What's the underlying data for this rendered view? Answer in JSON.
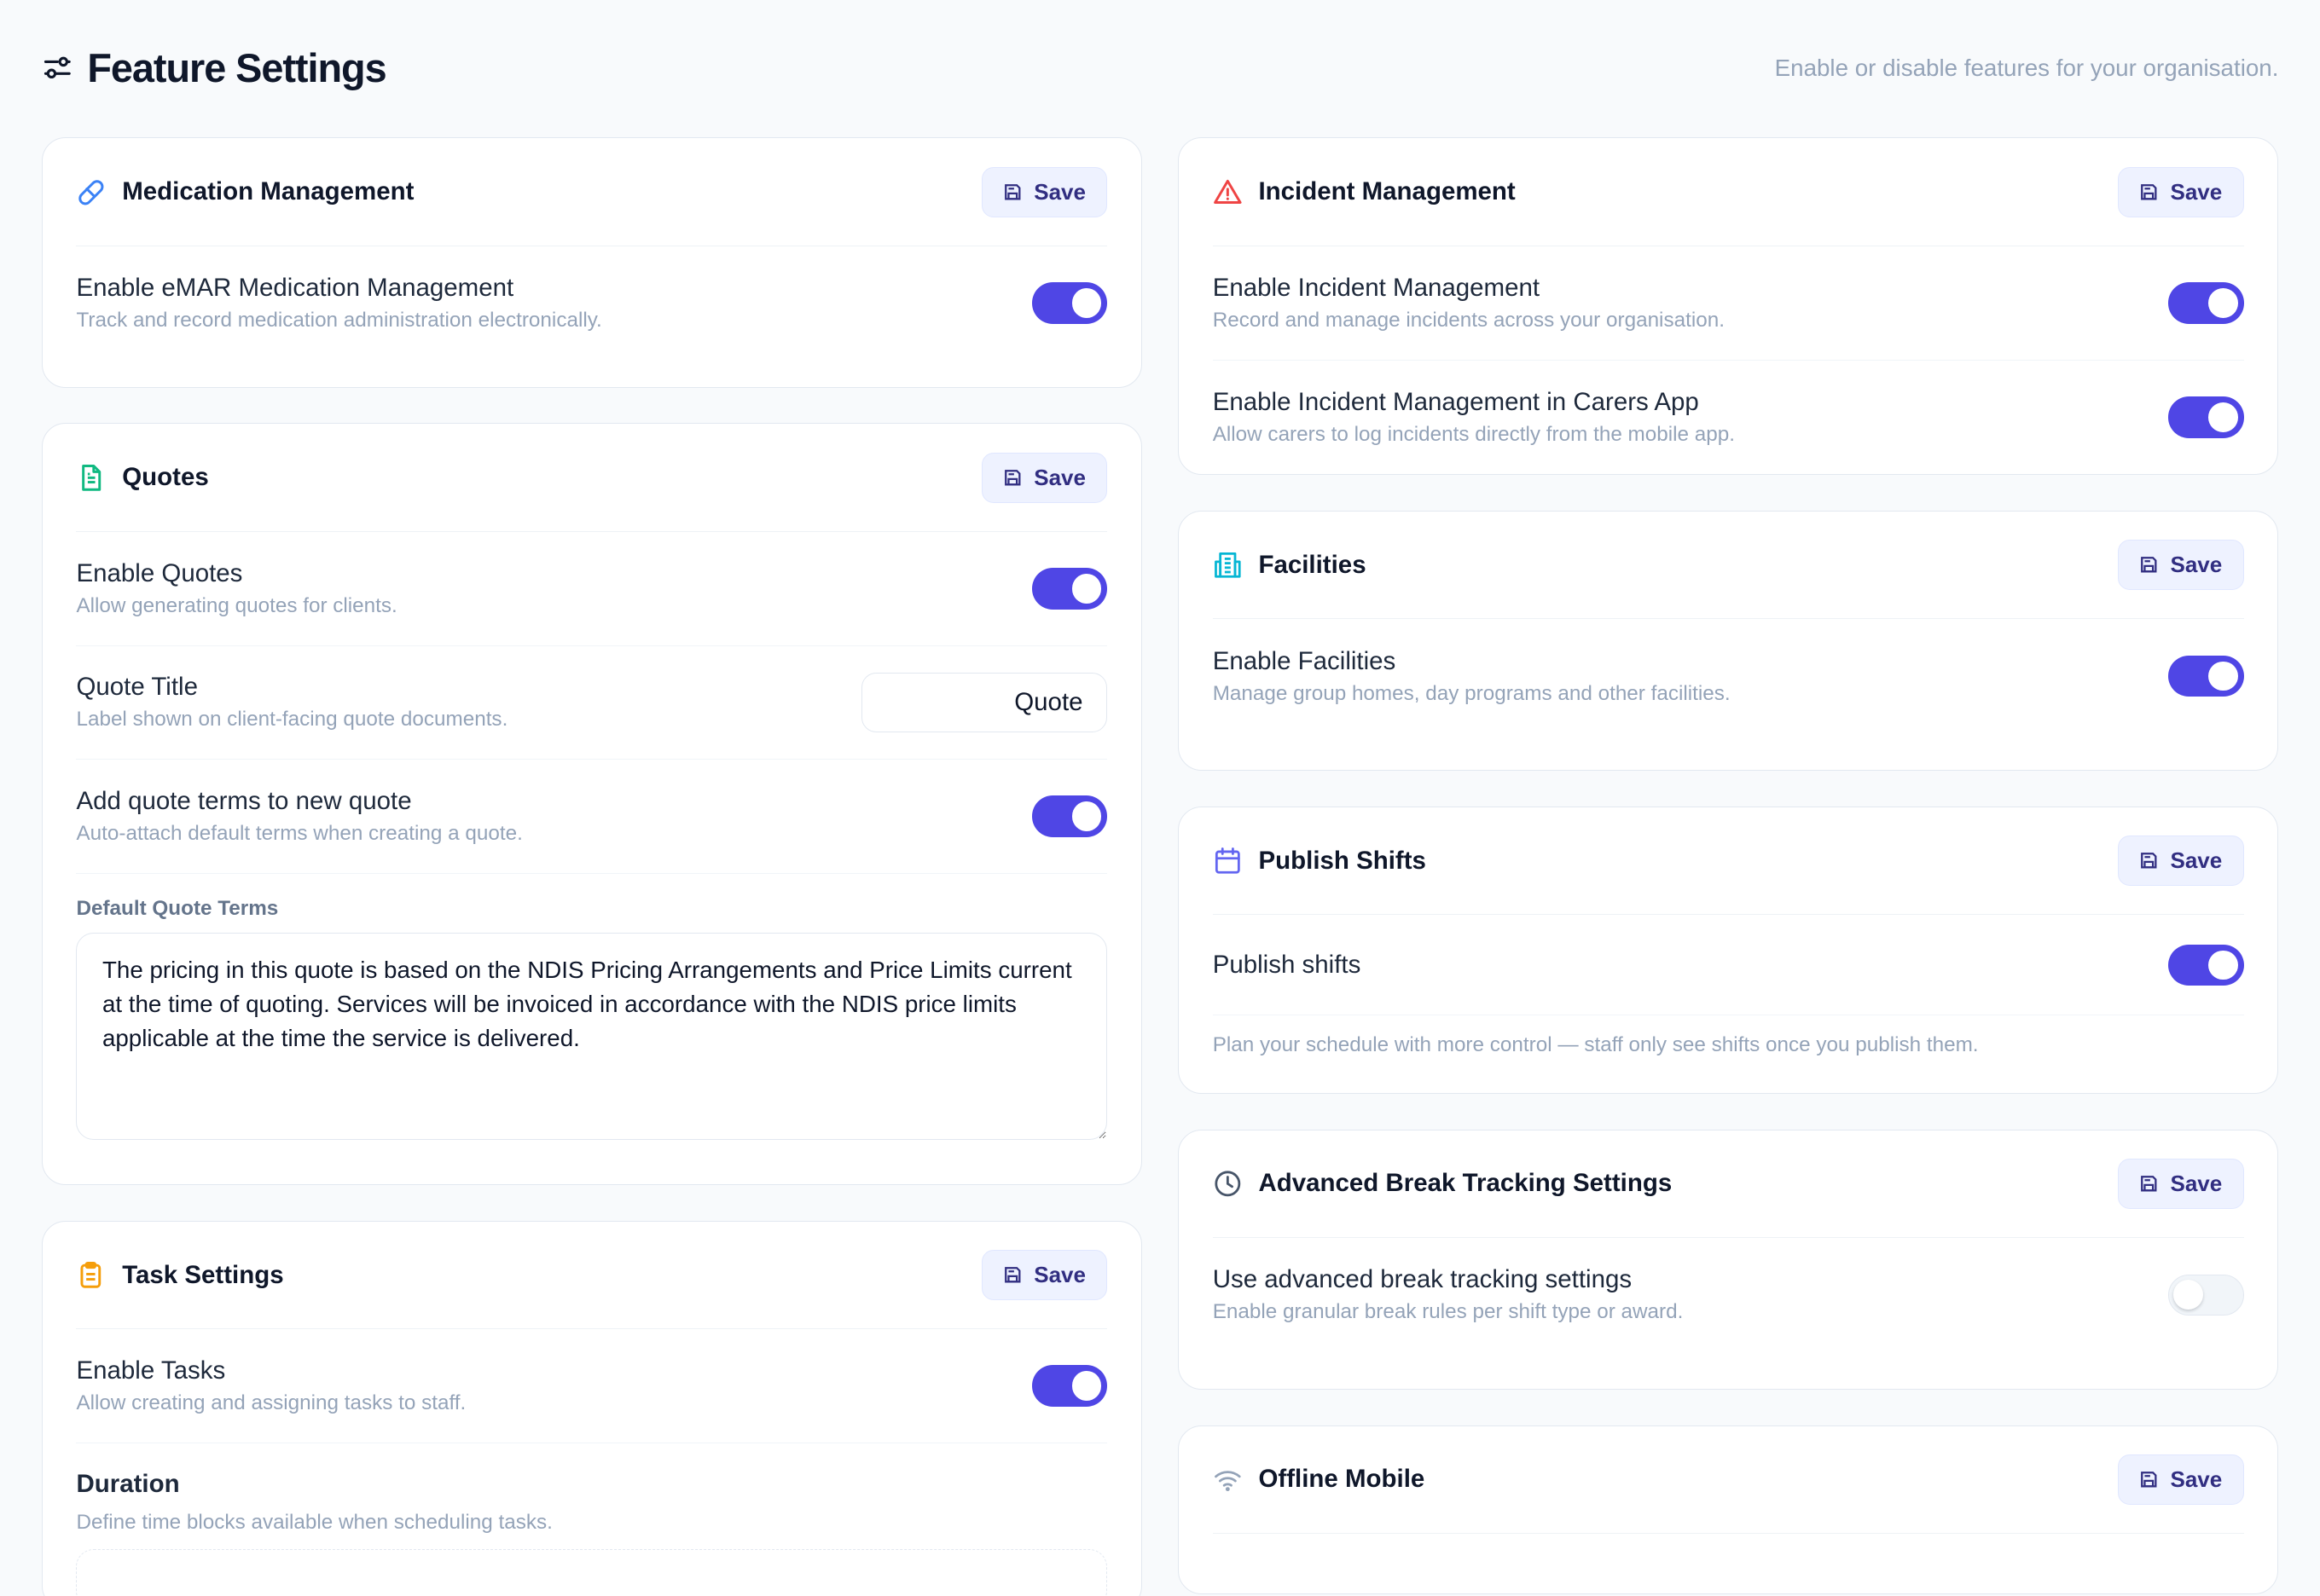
{
  "header": {
    "title": "Feature Settings",
    "subtitle": "Enable or disable features for your organisation.",
    "icon": "sliders-icon"
  },
  "colors": {
    "accent": "#4f46e5",
    "save_bg": "#eef2ff",
    "save_text": "#312e81",
    "muted_text": "#94a3b8",
    "icon_medication": "#3b82f6",
    "icon_quotes": "#10b981",
    "icon_tasks": "#f59e0b",
    "icon_incident": "#ef4444",
    "icon_facilities": "#06b6d4",
    "icon_publish": "#6366f1",
    "icon_break": "#475569",
    "icon_offline": "#94a3b8"
  },
  "save_label": "Save",
  "medication": {
    "title": "Medication Management",
    "icon": "pill-icon",
    "rows": [
      {
        "label": "Enable eMAR Medication Management",
        "desc": "Track and record medication administration electronically.",
        "enabled": true
      }
    ]
  },
  "quotes": {
    "title": "Quotes",
    "icon": "document-icon",
    "enable": {
      "label": "Enable Quotes",
      "desc": "Allow generating quotes for clients.",
      "enabled": true
    },
    "quote_title": {
      "label": "Quote Title",
      "desc": "Label shown on client-facing quote documents.",
      "value": "Quote"
    },
    "add_terms": {
      "label": "Add quote terms to new quote",
      "desc": "Auto-attach default terms when creating a quote.",
      "enabled": true
    },
    "default_terms": {
      "label": "Default Quote Terms",
      "value": "The pricing in this quote is based on the NDIS Pricing Arrangements and Price Limits current at the time of quoting. Services will be invoiced in accordance with the NDIS price limits applicable at the time the service is delivered."
    }
  },
  "tasks": {
    "title": "Task Settings",
    "icon": "clipboard-icon",
    "enable": {
      "label": "Enable Tasks",
      "desc": "Allow creating and assigning tasks to staff.",
      "enabled": true
    },
    "duration": {
      "title": "Duration",
      "desc": "Define time blocks available when scheduling tasks."
    }
  },
  "incident": {
    "title": "Incident Management",
    "icon": "warning-triangle-icon",
    "rows": [
      {
        "label": "Enable Incident Management",
        "desc": "Record and manage incidents across your organisation.",
        "enabled": true
      },
      {
        "label": "Enable Incident Management in Carers App",
        "desc": "Allow carers to log incidents directly from the mobile app.",
        "enabled": true
      }
    ]
  },
  "facilities": {
    "title": "Facilities",
    "icon": "building-icon",
    "rows": [
      {
        "label": "Enable Facilities",
        "desc": "Manage group homes, day programs and other facilities.",
        "enabled": true
      }
    ]
  },
  "publish": {
    "title": "Publish Shifts",
    "icon": "calendar-icon",
    "row": {
      "label": "Publish shifts",
      "enabled": true
    },
    "note": "Plan your schedule with more control — staff only see shifts once you publish them."
  },
  "break_tracking": {
    "title": "Advanced Break Tracking Settings",
    "icon": "clock-icon",
    "row": {
      "label": "Use advanced break tracking settings",
      "desc": "Enable granular break rules per shift type or award.",
      "enabled": false
    }
  },
  "offline": {
    "title": "Offline Mobile",
    "icon": "wifi-icon"
  }
}
